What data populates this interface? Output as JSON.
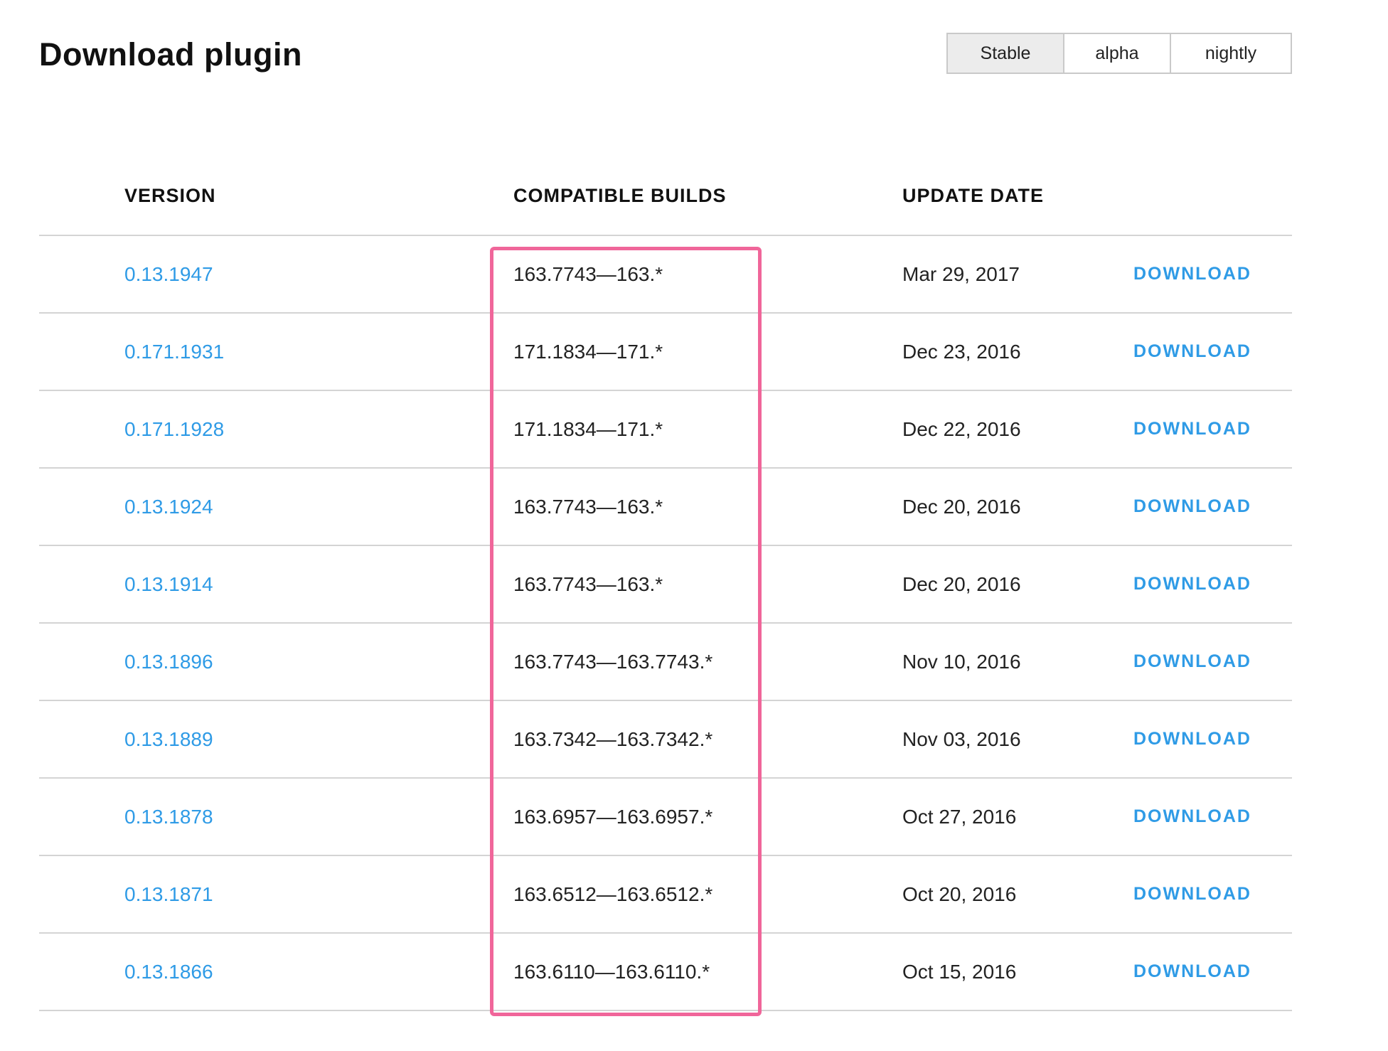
{
  "header": {
    "title": "Download plugin"
  },
  "channels": {
    "items": [
      {
        "label": "Stable",
        "active": true
      },
      {
        "label": "alpha",
        "active": false
      },
      {
        "label": "nightly",
        "active": false
      }
    ]
  },
  "table": {
    "columns": {
      "version": "VERSION",
      "builds": "COMPATIBLE BUILDS",
      "date": "UPDATE DATE"
    },
    "rows": [
      {
        "version": "0.13.1947",
        "builds": "163.7743—163.*",
        "date": "Mar 29, 2017",
        "action": "DOWNLOAD"
      },
      {
        "version": "0.171.1931",
        "builds": "171.1834—171.*",
        "date": "Dec 23, 2016",
        "action": "DOWNLOAD"
      },
      {
        "version": "0.171.1928",
        "builds": "171.1834—171.*",
        "date": "Dec 22, 2016",
        "action": "DOWNLOAD"
      },
      {
        "version": "0.13.1924",
        "builds": "163.7743—163.*",
        "date": "Dec 20, 2016",
        "action": "DOWNLOAD"
      },
      {
        "version": "0.13.1914",
        "builds": "163.7743—163.*",
        "date": "Dec 20, 2016",
        "action": "DOWNLOAD"
      },
      {
        "version": "0.13.1896",
        "builds": "163.7743—163.7743.*",
        "date": "Nov 10, 2016",
        "action": "DOWNLOAD"
      },
      {
        "version": "0.13.1889",
        "builds": "163.7342—163.7342.*",
        "date": "Nov 03, 2016",
        "action": "DOWNLOAD"
      },
      {
        "version": "0.13.1878",
        "builds": "163.6957—163.6957.*",
        "date": "Oct 27, 2016",
        "action": "DOWNLOAD"
      },
      {
        "version": "0.13.1871",
        "builds": "163.6512—163.6512.*",
        "date": "Oct 20, 2016",
        "action": "DOWNLOAD"
      },
      {
        "version": "0.13.1866",
        "builds": "163.6110—163.6110.*",
        "date": "Oct 15, 2016",
        "action": "DOWNLOAD"
      }
    ]
  },
  "colors": {
    "link": "#2f9be6",
    "highlight": "#f0669a",
    "divider": "#d4d4d4",
    "active_tab": "#ececec"
  }
}
